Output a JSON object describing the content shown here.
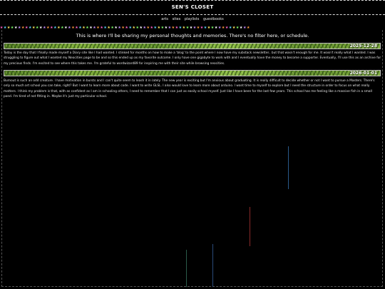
{
  "site": {
    "title": "SEN'S CLOSET"
  },
  "nav": {
    "items": [
      "arts",
      "sites",
      "playlists",
      "guestbooks"
    ]
  },
  "intro": "This is where I'll be sharing my personal thoughts and memories. There's no filter here, or schedule.",
  "entries": [
    {
      "date": "2025-12-28",
      "body": "Today is the day that I finally made myself a Diary site like I had wanted. I stinked for months on how to make a 'blog' to the point where I now have my substack newsletter.. but that wasn't enough for me. It wasn't really what I wanted. I was struggling to figure out what I wanted my Neocities page to be and so this ended up as my favorite outcome. I only have one gigabyte to work with and I eventually have the money to become a supporter. Eventually, I'll use this as an archive for my precious finds. I'm excited to see where this takes me. I'm grateful to wordwizard89 for inspiring me with their site while browsing neocities."
    },
    {
      "date": "2026-01-01",
      "body": "Burnout is such an odd creature. I have motivation in bursts and I can't quite seem to leash it in lately. The new year is exciting but I'm anxious about graduating. It is really difficult to decide whether or not I want to pursue a Masters. There's only so much art school you can take, right? But I want to learn more about code. I want to write GLSL. I also would love to learn more about arduino. I want time to myself to explore but I need the structure in order to focus on what really matters. I think my problem is that, with as confident as I am in schooling others, I need to remember that I can just as easily school myself. Just like I have been for the last few years. This school has me feeling like a massive fish in a small pond. I'm tired of not fitting in. Maybe it's just my particular school."
    }
  ],
  "colors": {
    "background": "#000000",
    "star_palette": [
      "#ff5fc8",
      "#59d7ff",
      "#ffe45c",
      "#7dff6a",
      "#ffffff",
      "#c58cff",
      "#ff9a3c"
    ]
  }
}
